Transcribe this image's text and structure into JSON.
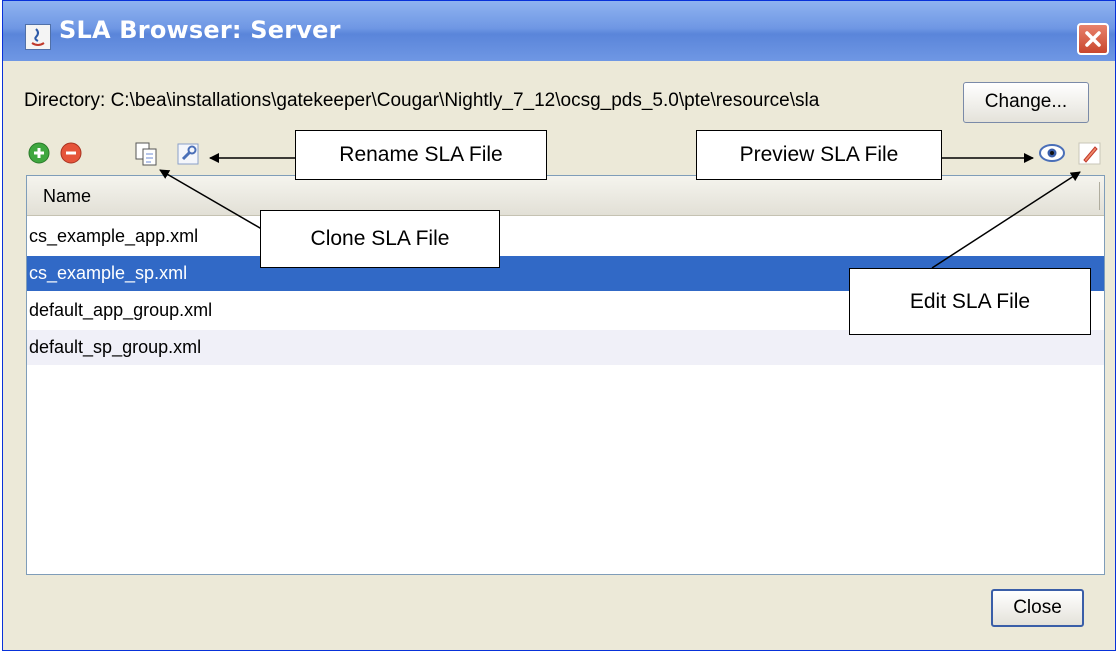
{
  "window": {
    "title": "SLA Browser: Server"
  },
  "directory": {
    "label": "Directory: C:\\bea\\installations\\gatekeeper\\Cougar\\Nightly_7_12\\ocsg_pds_5.0\\pte\\resource\\sla",
    "change_label": "Change..."
  },
  "toolbar": {
    "icons": [
      "add-icon",
      "remove-icon",
      "clone-icon",
      "rename-icon",
      "preview-icon",
      "edit-icon"
    ]
  },
  "table": {
    "column_header": "Name",
    "rows": [
      "cs_example_app.xml",
      "cs_example_sp.xml",
      "default_app_group.xml",
      "default_sp_group.xml"
    ],
    "selected_index": 1
  },
  "annotations": {
    "rename": "Rename SLA File",
    "preview": "Preview SLA File",
    "clone": "Clone SLA File",
    "edit": "Edit SLA File"
  },
  "footer": {
    "close_label": "Close"
  },
  "colors": {
    "selection": "#3169c6",
    "window_bg": "#ece9d8",
    "titlebar": "#6f97e4"
  }
}
